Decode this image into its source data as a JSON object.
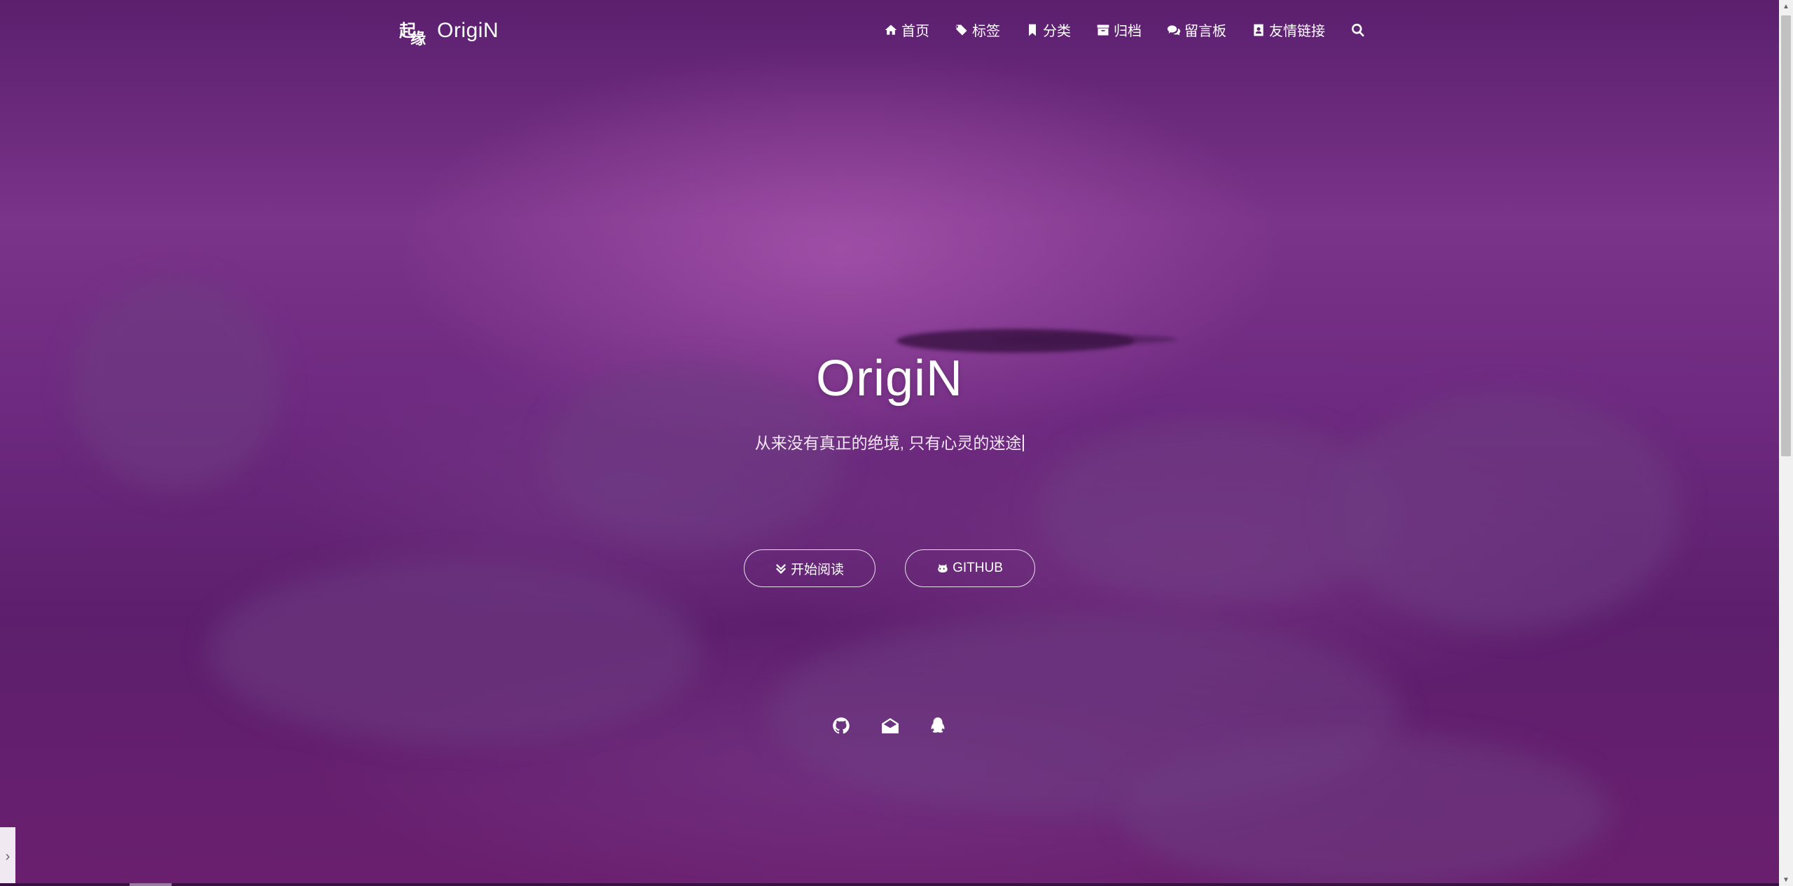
{
  "brand": {
    "logo_text_top": "起",
    "logo_text_bottom": "缘",
    "name": "OrigiN"
  },
  "nav": {
    "items": [
      {
        "label": "首页",
        "icon": "home-icon"
      },
      {
        "label": "标签",
        "icon": "tags-icon"
      },
      {
        "label": "分类",
        "icon": "bookmark-icon"
      },
      {
        "label": "归档",
        "icon": "archive-icon"
      },
      {
        "label": "留言板",
        "icon": "comments-icon"
      },
      {
        "label": "友情链接",
        "icon": "address-card-icon"
      }
    ],
    "search_icon": "search-icon"
  },
  "hero": {
    "title": "OrigiN",
    "subtitle": "从来没有真正的绝境, 只有心灵的迷途"
  },
  "buttons": {
    "read": "开始阅读",
    "github": "GITHUB"
  },
  "social": [
    {
      "icon": "github-icon"
    },
    {
      "icon": "envelope-icon"
    },
    {
      "icon": "qq-icon"
    }
  ],
  "colors": {
    "hero_purple": "#6e2a80",
    "accent_light": "#f3e6f5"
  }
}
